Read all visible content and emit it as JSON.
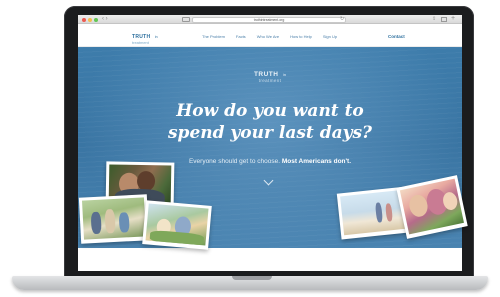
{
  "browser": {
    "url": "truthintreatment.org",
    "nav_glyph": "‹ ›",
    "reload_glyph": "↻",
    "share_glyph": "⇪",
    "plus_glyph": "+"
  },
  "header": {
    "logo_main": "TRUTH",
    "logo_small": "in",
    "logo_sub": "treatment",
    "nav": [
      "The Problem",
      "Facts",
      "Who We Are",
      "How to Help",
      "Sign Up"
    ],
    "contact": "Contact"
  },
  "hero": {
    "brand_main": "TRUTH",
    "brand_small": "in",
    "brand_sub": "treatment",
    "title_line1": "How do you want to",
    "title_line2": "spend your last days?",
    "subtitle_plain": "Everyone should get to choose.",
    "subtitle_bold": "Most Americans don't."
  },
  "colors": {
    "brand_blue": "#2c6f9e",
    "hero_blue": "#3d7cab"
  }
}
